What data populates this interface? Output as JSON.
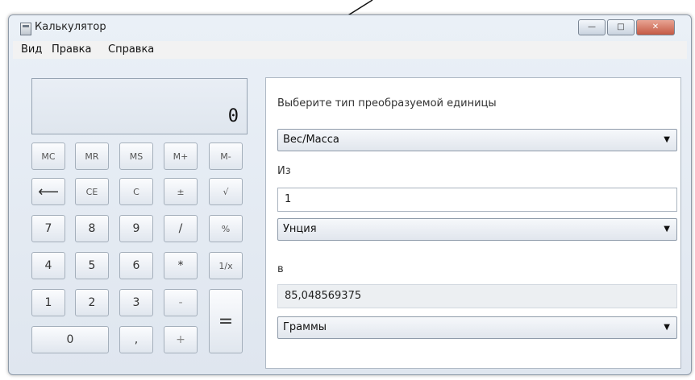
{
  "window": {
    "title": "Калькулятор",
    "caption": {
      "minimize": "—",
      "maximize": "□",
      "close": "✕"
    }
  },
  "menu": [
    "Вид",
    "Правка",
    "Справка"
  ],
  "display": {
    "value": "0"
  },
  "keypad": {
    "memory": [
      "MC",
      "MR",
      "MS",
      "M+",
      "M-"
    ],
    "row2": [
      "⟵",
      "CE",
      "C",
      "±",
      "√"
    ],
    "row3": [
      "7",
      "8",
      "9",
      "/",
      "%"
    ],
    "row4": [
      "4",
      "5",
      "6",
      "*",
      "1/x"
    ],
    "row5": [
      "1",
      "2",
      "3",
      "-"
    ],
    "row6": [
      "0",
      ",",
      "+"
    ],
    "equals": "="
  },
  "converter": {
    "heading": "Выберите тип преобразуемой единицы",
    "type_selected": "Вес/Масса",
    "from_label": "Из",
    "from_value": "1",
    "from_unit": "Унция",
    "to_label": "в",
    "to_value": "85,048569375",
    "to_unit": "Граммы"
  },
  "icons": {
    "app": "calculator-icon",
    "dropdown": "chevron-down-icon"
  }
}
